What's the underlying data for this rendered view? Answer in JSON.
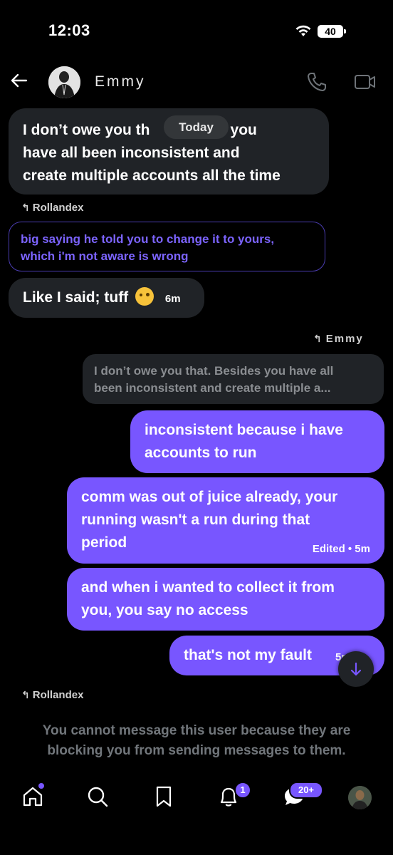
{
  "status_bar": {
    "time": "12:03",
    "battery": "40"
  },
  "header": {
    "contact_name": "Emmy"
  },
  "conversation": {
    "date_divider": "Today",
    "msg1": {
      "line1a": "I don’t owe you th",
      "line1b": "les you",
      "line2": "have all been inconsistent and",
      "line3": "create multiple accounts all the time"
    },
    "reply1": {
      "author": "Rollandex",
      "quote_line1": "big saying he told you to change it to yours,",
      "quote_line2": "which i'm not aware is wrong"
    },
    "msg2": {
      "text": "Like I said; tuff",
      "time": "6m"
    },
    "reply2": {
      "author": "Emmy",
      "quote_line1": "I don’t owe you that. Besides you have all",
      "quote_line2": "been inconsistent and create multiple a..."
    },
    "msg3": {
      "line1": "inconsistent because i have",
      "line2": "accounts to run"
    },
    "msg4": {
      "line1": "comm was out of juice already, your",
      "line2": "running wasn't a run during that",
      "line3": "period",
      "meta": "Edited • 5m"
    },
    "msg5": {
      "line1": "and when i wanted to collect it from",
      "line2": "you, you say no access"
    },
    "msg6": {
      "text": "that's not my fault",
      "time": "5m"
    },
    "reply3": {
      "author": "Rollandex"
    },
    "blocked_line1": "You cannot message this user because they are",
    "blocked_line2": "blocking you from sending messages to them."
  },
  "nav": {
    "notifications_badge": "1",
    "messages_badge": "20+"
  },
  "colors": {
    "accent": "#7856ff",
    "incoming_bubble": "#202327",
    "muted_text": "#71767b"
  }
}
